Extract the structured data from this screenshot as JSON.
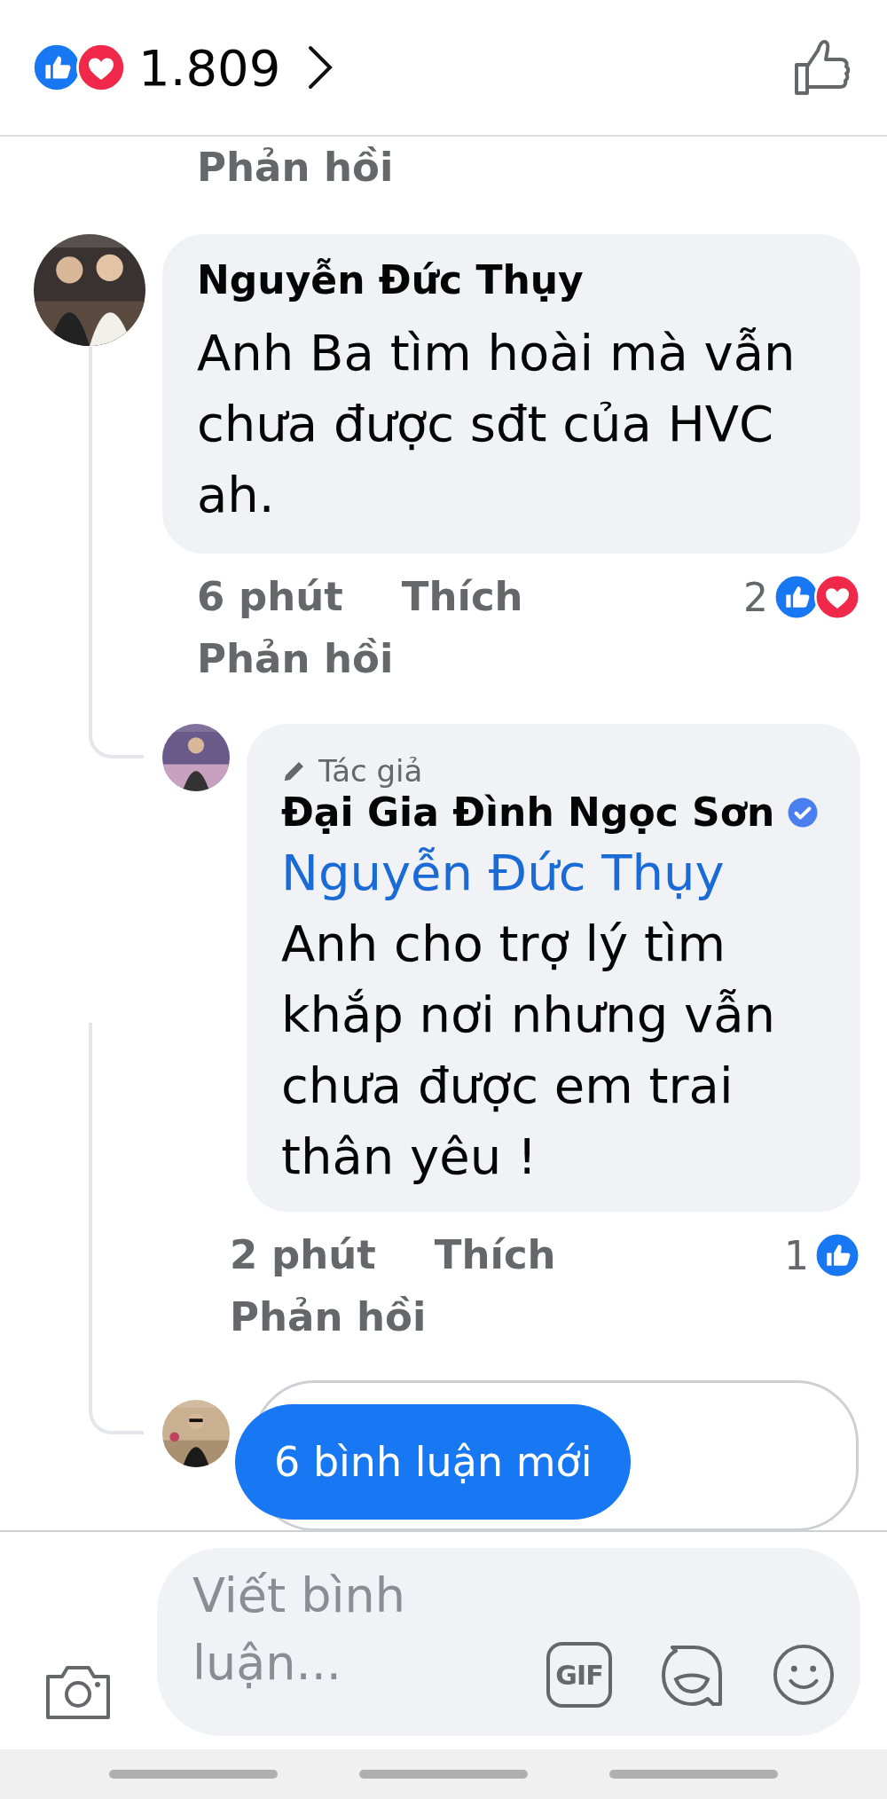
{
  "header": {
    "reactions": [
      {
        "kind": "like"
      },
      {
        "kind": "love"
      }
    ],
    "count": "1.809"
  },
  "feed": {
    "top_reply_link": "Phản hồi",
    "comments": [
      {
        "author": "Nguyễn Đức Thụy",
        "text": "Anh Ba tìm hoài mà vẫn chưa được sđt của HVC ah.",
        "time": "6 phút",
        "like_label": "Thích",
        "reply_label": "Phản hồi",
        "reaction_count": "2",
        "reactions": [
          {
            "kind": "like"
          },
          {
            "kind": "love"
          }
        ],
        "replies": [
          {
            "kind": "comment",
            "badge": "Tác giả",
            "author": "Đại Gia Đình Ngọc Sơn",
            "verified": true,
            "mention": "Nguyễn Đức Thụy",
            "text": "Anh cho trợ lý tìm khắp nơi nhưng vẫn chưa được em trai thân yêu !",
            "time": "2 phút",
            "like_label": "Thích",
            "reply_label": "Phản hồi",
            "reaction_count": "1",
            "reactions": [
              {
                "kind": "like"
              }
            ]
          },
          {
            "kind": "partial"
          }
        ]
      }
    ],
    "new_comments_button": "6 bình luận mới"
  },
  "composer": {
    "placeholder": "Viết bình luận...",
    "gif_label": "GIF"
  }
}
